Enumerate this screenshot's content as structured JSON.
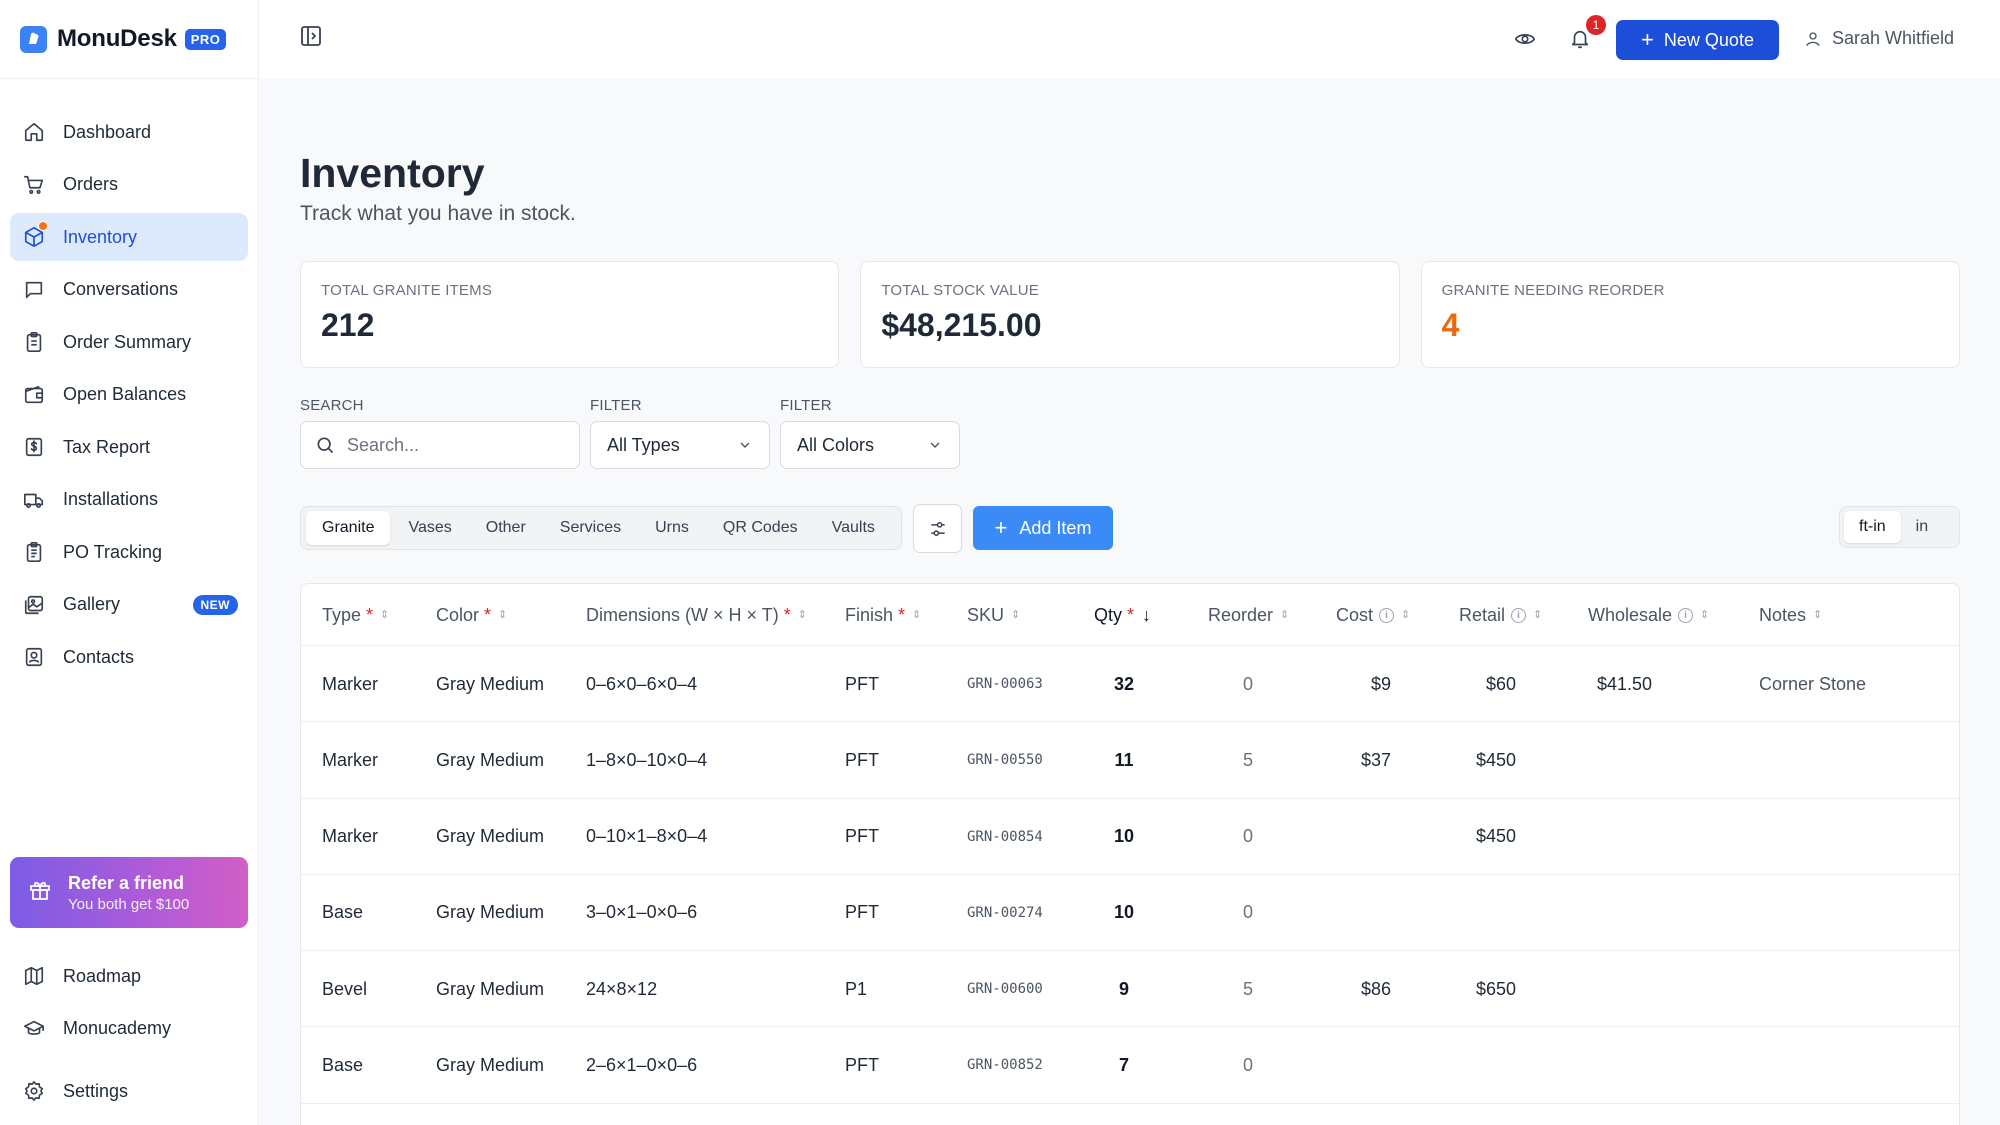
{
  "brand": {
    "name": "MonuDesk",
    "badge": "PRO"
  },
  "sidebar": {
    "items": [
      {
        "label": "Dashboard",
        "icon": "home-icon"
      },
      {
        "label": "Orders",
        "icon": "cart-icon"
      },
      {
        "label": "Inventory",
        "icon": "box-icon",
        "active": true
      },
      {
        "label": "Conversations",
        "icon": "chat-icon"
      },
      {
        "label": "Order Summary",
        "icon": "clipboard-icon"
      },
      {
        "label": "Open Balances",
        "icon": "wallet-icon"
      },
      {
        "label": "Tax Report",
        "icon": "dollar-receipt-icon"
      },
      {
        "label": "Installations",
        "icon": "truck-icon"
      },
      {
        "label": "PO Tracking",
        "icon": "clipboard-list-icon"
      },
      {
        "label": "Gallery",
        "icon": "images-icon",
        "badge": "NEW"
      },
      {
        "label": "Contacts",
        "icon": "contact-icon"
      }
    ],
    "refer": {
      "title": "Refer a friend",
      "subtitle": "You both get $100"
    },
    "bottom": [
      {
        "label": "Roadmap",
        "icon": "map-icon"
      },
      {
        "label": "Monucademy",
        "icon": "graduation-cap-icon"
      },
      {
        "label": "Settings",
        "icon": "gear-icon"
      }
    ]
  },
  "topbar": {
    "notification_count": "1",
    "new_quote_label": "New Quote",
    "user_name": "Sarah Whitfield"
  },
  "page": {
    "title": "Inventory",
    "subtitle": "Track what you have in stock."
  },
  "stats": [
    {
      "label": "TOTAL GRANITE ITEMS",
      "value": "212"
    },
    {
      "label": "TOTAL STOCK VALUE",
      "value": "$48,215.00"
    },
    {
      "label": "GRANITE NEEDING REORDER",
      "value": "4",
      "color": "#ea6a0c"
    }
  ],
  "filters": {
    "search_label": "SEARCH",
    "search_placeholder": "Search...",
    "type_label": "FILTER",
    "type_value": "All Types",
    "color_label": "FILTER",
    "color_value": "All Colors"
  },
  "tabs": [
    "Granite",
    "Vases",
    "Other",
    "Services",
    "Urns",
    "QR Codes",
    "Vaults"
  ],
  "active_tab": "Granite",
  "add_item_label": "Add Item",
  "units": [
    "ft-in",
    "in"
  ],
  "active_unit": "ft-in",
  "table": {
    "columns": [
      "Type",
      "Color",
      "Dimensions (W × H × T)",
      "Finish",
      "SKU",
      "Qty",
      "Reorder",
      "Cost",
      "Retail",
      "Wholesale",
      "Notes"
    ],
    "rows": [
      {
        "type": "Marker",
        "color": "Gray Medium",
        "dimensions": "0–6×0–6×0–4",
        "finish": "PFT",
        "sku": "GRN-00063",
        "qty": "32",
        "reorder": "0",
        "cost": "$9",
        "retail": "$60",
        "wholesale": "$41.50",
        "notes": "Corner Stone"
      },
      {
        "type": "Marker",
        "color": "Gray Medium",
        "dimensions": "1–8×0–10×0–4",
        "finish": "PFT",
        "sku": "GRN-00550",
        "qty": "11",
        "reorder": "5",
        "cost": "$37",
        "retail": "$450",
        "wholesale": "",
        "notes": ""
      },
      {
        "type": "Marker",
        "color": "Gray Medium",
        "dimensions": "0–10×1–8×0–4",
        "finish": "PFT",
        "sku": "GRN-00854",
        "qty": "10",
        "reorder": "0",
        "cost": "",
        "retail": "$450",
        "wholesale": "",
        "notes": ""
      },
      {
        "type": "Base",
        "color": "Gray Medium",
        "dimensions": "3–0×1–0×0–6",
        "finish": "PFT",
        "sku": "GRN-00274",
        "qty": "10",
        "reorder": "0",
        "cost": "",
        "retail": "",
        "wholesale": "",
        "notes": ""
      },
      {
        "type": "Bevel",
        "color": "Gray Medium",
        "dimensions": "24×8×12",
        "finish": "P1",
        "sku": "GRN-00600",
        "qty": "9",
        "reorder": "5",
        "cost": "$86",
        "retail": "$650",
        "wholesale": "",
        "notes": ""
      },
      {
        "type": "Base",
        "color": "Gray Medium",
        "dimensions": "2–6×1–0×0–6",
        "finish": "PFT",
        "sku": "GRN-00852",
        "qty": "7",
        "reorder": "0",
        "cost": "",
        "retail": "",
        "wholesale": "",
        "notes": ""
      }
    ]
  },
  "colors": {
    "accent": "#1d4ed8",
    "accent_light": "#3b8bf6",
    "warning": "#ea6a0c",
    "danger": "#dc2626"
  }
}
